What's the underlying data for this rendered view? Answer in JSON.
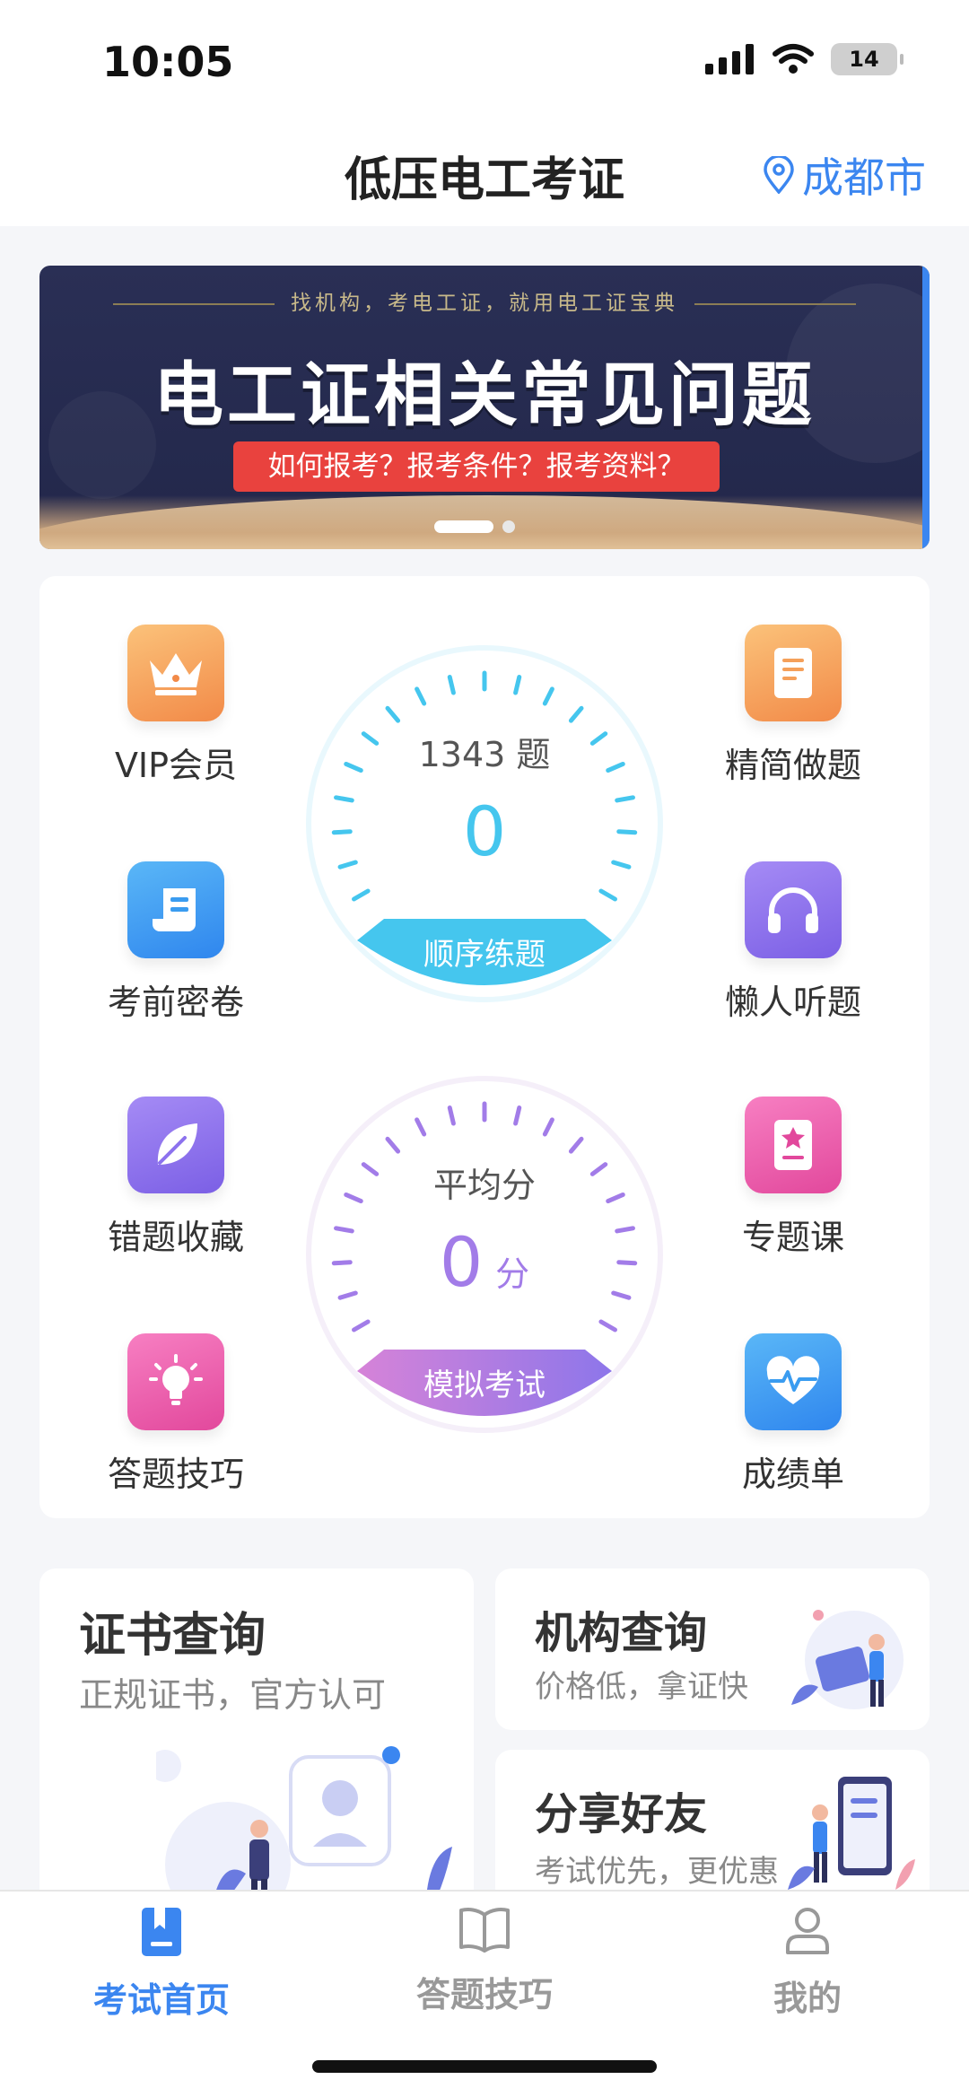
{
  "status_bar": {
    "time": "10:05",
    "battery": "14"
  },
  "header": {
    "title": "低压电工考证",
    "city": "成都市"
  },
  "banner": {
    "tagline": "找机构，考电工证，就用电工证宝典",
    "headline": "电工证相关常见问题",
    "pill": "如何报考？报考条件？报考资料？"
  },
  "features": {
    "left": [
      {
        "label": "VIP会员",
        "icon": "crown-icon",
        "color": "#f5a05a"
      },
      {
        "label": "考前密卷",
        "icon": "scroll-icon",
        "color": "#3a9cf0"
      },
      {
        "label": "错题收藏",
        "icon": "leaf-icon",
        "color": "#8c72ee"
      },
      {
        "label": "答题技巧",
        "icon": "lightbulb-icon",
        "color": "#ec5aa8"
      }
    ],
    "right": [
      {
        "label": "精简做题",
        "icon": "document-icon",
        "color": "#f5a05a"
      },
      {
        "label": "懒人听题",
        "icon": "headphones-icon",
        "color": "#8c72ee"
      },
      {
        "label": "专题课",
        "icon": "badge-book-icon",
        "color": "#ec5aa8"
      },
      {
        "label": "成绩单",
        "icon": "heart-pulse-icon",
        "color": "#3a9cf0"
      }
    ]
  },
  "practice_dial": {
    "count": "1343 题",
    "value": "0",
    "button": "顺序练题",
    "color": "#45c6ee"
  },
  "exam_dial": {
    "label": "平均分",
    "value": "0",
    "unit": "分",
    "button": "模拟考试",
    "color": "#a27ce8"
  },
  "cards": {
    "certificate": {
      "title": "证书查询",
      "subtitle": "正规证书，官方认可"
    },
    "institution": {
      "title": "机构查询",
      "subtitle": "价格低，拿证快"
    },
    "share": {
      "title": "分享好友",
      "subtitle": "考试优先，更优惠"
    }
  },
  "tabbar": {
    "home": "考试首页",
    "tips": "答题技巧",
    "mine": "我的"
  }
}
